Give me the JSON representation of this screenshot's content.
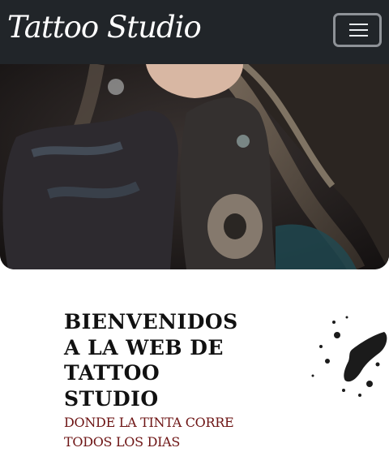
{
  "navbar": {
    "brand": "Tattoo Studio",
    "toggle_icon": "hamburger-icon"
  },
  "hero": {
    "image": "tattooed-person-hero-photo"
  },
  "welcome": {
    "title": "BIENVENIDOS A LA WEB DE TATTOO STUDIO",
    "subtitle": "DONDE LA TINTA CORRE TODOS LOS DIAS"
  },
  "decor": {
    "ink_splash": "ink-splash-image"
  },
  "colors": {
    "navbar_bg": "#212529",
    "subtitle": "#6d1414",
    "title": "#111111"
  }
}
